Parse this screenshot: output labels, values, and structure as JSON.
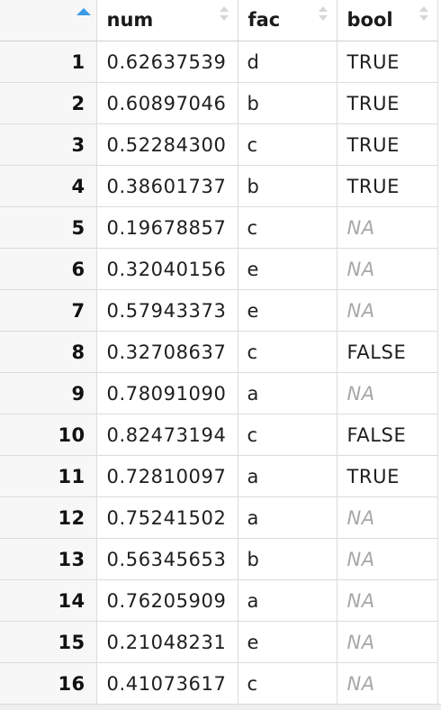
{
  "headers": {
    "index": "",
    "num": "num",
    "fac": "fac",
    "bool": "bool"
  },
  "sort": {
    "column": "index",
    "direction": "ascending",
    "active_color": "#3a9ae8"
  },
  "na_label": "NA",
  "rows": [
    {
      "index": "1",
      "num": "0.62637539",
      "fac": "d",
      "bool": "TRUE"
    },
    {
      "index": "2",
      "num": "0.60897046",
      "fac": "b",
      "bool": "TRUE"
    },
    {
      "index": "3",
      "num": "0.52284300",
      "fac": "c",
      "bool": "TRUE"
    },
    {
      "index": "4",
      "num": "0.38601737",
      "fac": "b",
      "bool": "TRUE"
    },
    {
      "index": "5",
      "num": "0.19678857",
      "fac": "c",
      "bool": "NA"
    },
    {
      "index": "6",
      "num": "0.32040156",
      "fac": "e",
      "bool": "NA"
    },
    {
      "index": "7",
      "num": "0.57943373",
      "fac": "e",
      "bool": "NA"
    },
    {
      "index": "8",
      "num": "0.32708637",
      "fac": "c",
      "bool": "FALSE"
    },
    {
      "index": "9",
      "num": "0.78091090",
      "fac": "a",
      "bool": "NA"
    },
    {
      "index": "10",
      "num": "0.82473194",
      "fac": "c",
      "bool": "FALSE"
    },
    {
      "index": "11",
      "num": "0.72810097",
      "fac": "a",
      "bool": "TRUE"
    },
    {
      "index": "12",
      "num": "0.75241502",
      "fac": "a",
      "bool": "NA"
    },
    {
      "index": "13",
      "num": "0.56345653",
      "fac": "b",
      "bool": "NA"
    },
    {
      "index": "14",
      "num": "0.76205909",
      "fac": "a",
      "bool": "NA"
    },
    {
      "index": "15",
      "num": "0.21048231",
      "fac": "e",
      "bool": "NA"
    },
    {
      "index": "16",
      "num": "0.41073617",
      "fac": "c",
      "bool": "NA"
    }
  ]
}
